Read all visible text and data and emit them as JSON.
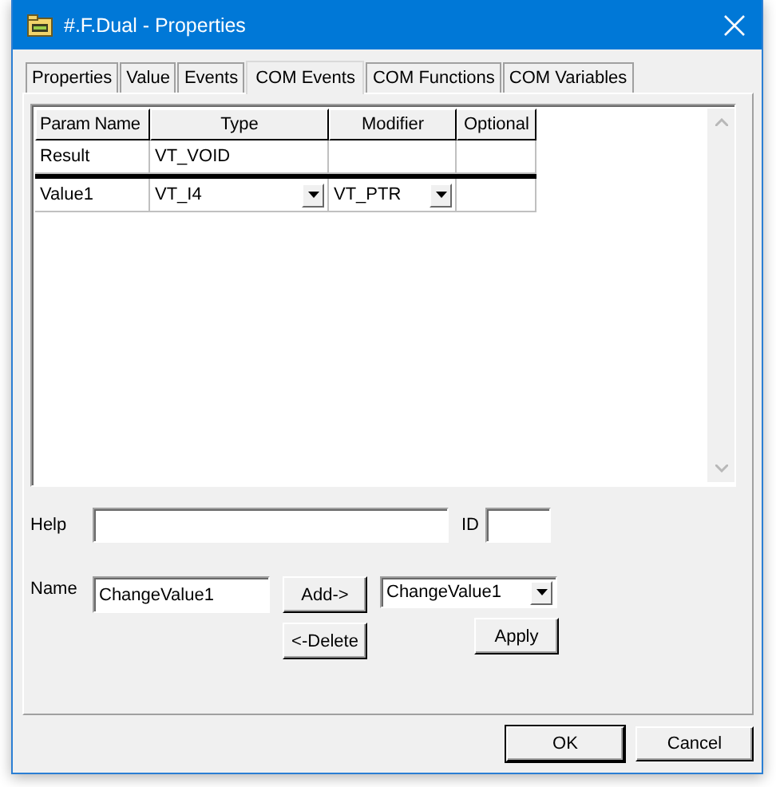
{
  "window": {
    "title": "#.F.Dual - Properties"
  },
  "tabs": [
    {
      "label": "Properties",
      "selected": false
    },
    {
      "label": "Value",
      "selected": false
    },
    {
      "label": "Events",
      "selected": false
    },
    {
      "label": "COM Events",
      "selected": true
    },
    {
      "label": "COM Functions",
      "selected": false
    },
    {
      "label": "COM Variables",
      "selected": false
    }
  ],
  "table": {
    "columns": [
      "Param Name",
      "Type",
      "Modifier",
      "Optional"
    ],
    "rows": [
      {
        "selected": false,
        "cells": [
          {
            "kind": "text",
            "value": "Result"
          },
          {
            "kind": "text",
            "value": "VT_VOID"
          },
          {
            "kind": "text"
          },
          {
            "kind": "text"
          }
        ]
      },
      {
        "selected": true,
        "cells": [
          {
            "kind": "text",
            "value": "Value1"
          },
          {
            "kind": "dropdown",
            "value": "VT_I4"
          },
          {
            "kind": "dropdown",
            "value": "VT_PTR"
          },
          {
            "kind": "text"
          }
        ]
      }
    ]
  },
  "help": {
    "label": "Help"
  },
  "id": {
    "label": "ID"
  },
  "name": {
    "label": "Name",
    "value": "ChangeValue1"
  },
  "add_button": "Add->",
  "delete_button": "<-Delete",
  "name_combo": {
    "value": "ChangeValue1"
  },
  "apply_button": "Apply",
  "buttons": [
    "OK",
    "Cancel"
  ]
}
